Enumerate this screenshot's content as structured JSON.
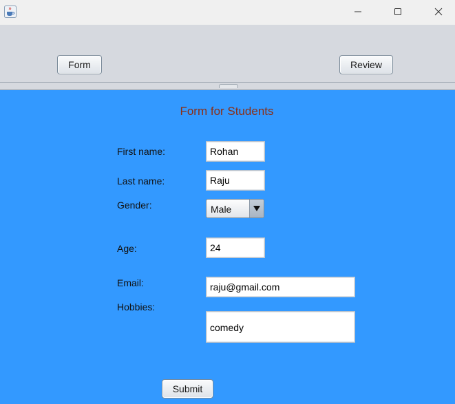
{
  "window": {
    "icons": {
      "app": "java-cup-icon",
      "minimize": "minimize-icon",
      "maximize": "maximize-icon",
      "close": "close-icon"
    }
  },
  "top_panel": {
    "form_button": "Form",
    "review_button": "Review"
  },
  "form": {
    "title": "Form for Students",
    "first_name": {
      "label": "First name:",
      "value": "Rohan"
    },
    "last_name": {
      "label": "Last name:",
      "value": "Raju"
    },
    "gender": {
      "label": "Gender:",
      "value": "Male"
    },
    "age": {
      "label": "Age:",
      "value": "24"
    },
    "email": {
      "label": "Email:",
      "value": "raju@gmail.com"
    },
    "hobbies": {
      "label": "Hobbies:",
      "value": "comedy"
    },
    "submit": "Submit"
  },
  "colors": {
    "form_background": "#3399ff",
    "title_text": "#8b2e14",
    "panel_background": "#d6d9df"
  }
}
